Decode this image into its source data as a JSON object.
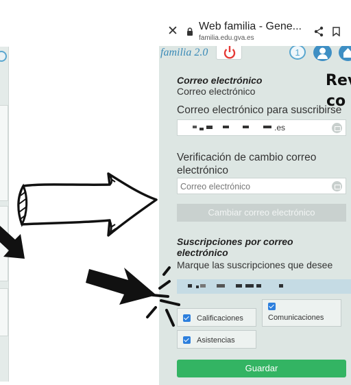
{
  "browser": {
    "title": "Web familia - Gene...",
    "url": "familia.edu.gva.es",
    "icons": [
      "close-icon",
      "lock-icon",
      "share-icon",
      "bookmark-icon",
      "more-vert-icon"
    ]
  },
  "app": {
    "name": "familia 2.0",
    "notification_count": "1",
    "brand_color": "#3a8ab7",
    "power_color": "#e53935"
  },
  "email_section": {
    "title": "Correo electrónico",
    "subtitle": "Correo electrónico",
    "subscribe_label": "Correo electrónico para suscribirse",
    "subscribe_value_suffix": ".es",
    "verify_label": "Verificación de cambio correo electrónico",
    "verify_placeholder": "Correo electrónico",
    "change_button": "Cambiar correo electrónico"
  },
  "subscriptions": {
    "title": "Suscripciones por correo electrónico",
    "instruction": "Marque las suscripciones que desee",
    "options": [
      {
        "label": "Calificaciones",
        "checked": true
      },
      {
        "label": "Comunicaciones",
        "checked": true
      },
      {
        "label": "Asistencias",
        "checked": true
      }
    ],
    "save_button": "Guardar",
    "save_color": "#33b463"
  },
  "overlay": {
    "partial_title_line1": "Rev",
    "partial_title_line2": "co"
  }
}
